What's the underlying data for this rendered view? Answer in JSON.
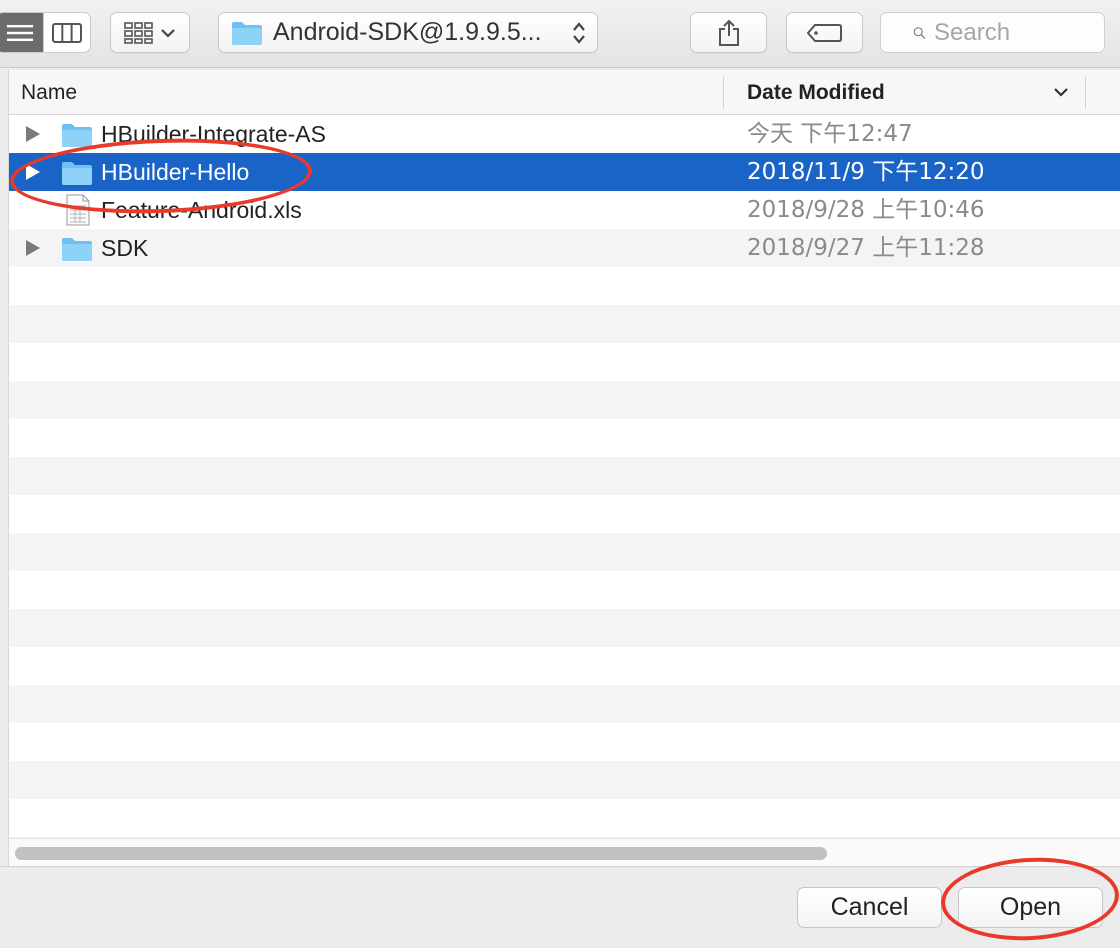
{
  "toolbar": {
    "view_modes": [
      "list-view-icon",
      "column-view-icon"
    ],
    "arrange_icon": "grid-icon",
    "path_label": "Android-SDK@1.9.9.5...",
    "share_icon": "share-icon",
    "tag_icon": "tag-icon",
    "search_placeholder": "Search"
  },
  "list": {
    "columns": {
      "name": "Name",
      "date_modified": "Date Modified"
    },
    "rows": [
      {
        "name": "HBuilder-Integrate-AS",
        "date": "今天 下午12:47",
        "type": "folder",
        "expandable": true,
        "selected": false
      },
      {
        "name": "HBuilder-Hello",
        "date": "2018/11/9 下午12:20",
        "type": "folder",
        "expandable": true,
        "selected": true
      },
      {
        "name": "Feature-Android.xls",
        "date": "2018/9/28 上午10:46",
        "type": "spreadsheet",
        "expandable": false,
        "selected": false
      },
      {
        "name": "SDK",
        "date": "2018/9/27 上午11:28",
        "type": "folder",
        "expandable": true,
        "selected": false
      }
    ]
  },
  "buttons": {
    "cancel": "Cancel",
    "open": "Open"
  },
  "colors": {
    "selection": "#1a64c8",
    "annotation": "#e8392b",
    "folder": "#6cc0f2"
  }
}
